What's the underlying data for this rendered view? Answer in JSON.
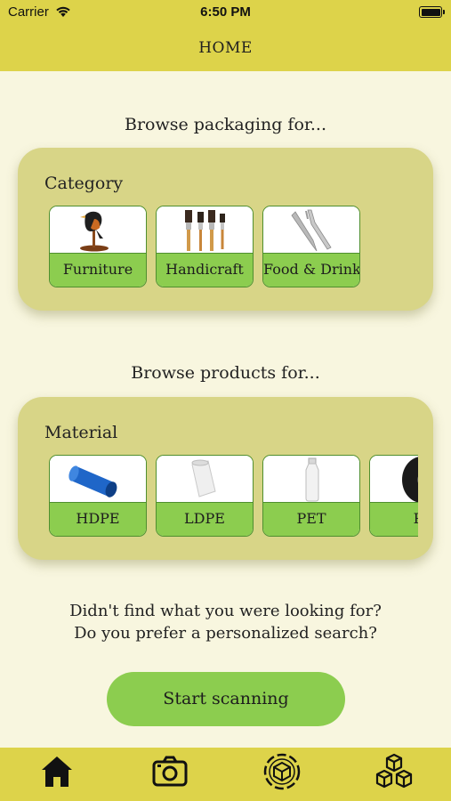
{
  "status_bar": {
    "carrier": "Carrier",
    "time": "6:50 PM",
    "battery": "full"
  },
  "nav": {
    "title": "HOME"
  },
  "packaging": {
    "heading": "Browse packaging for...",
    "label": "Category",
    "items": [
      {
        "label": "Furniture",
        "icon": "bird-figurine-icon"
      },
      {
        "label": "Handicraft",
        "icon": "paintbrushes-icon"
      },
      {
        "label": "Food & Drinks",
        "icon": "cutlery-icon"
      }
    ]
  },
  "products": {
    "heading": "Browse products for...",
    "label": "Material",
    "items": [
      {
        "label": "HDPE",
        "icon": "blue-pipe-icon"
      },
      {
        "label": "LDPE",
        "icon": "film-roll-icon"
      },
      {
        "label": "PET",
        "icon": "plastic-bottle-icon"
      },
      {
        "label": "P",
        "icon": "black-roll-icon"
      }
    ]
  },
  "prompt": {
    "line1": "Didn't find what you were looking for?",
    "line2": "Do you prefer a personalized search?"
  },
  "scan_button": {
    "label": "Start scanning"
  },
  "tabs": [
    {
      "name": "home",
      "icon": "home-icon",
      "active": true
    },
    {
      "name": "camera",
      "icon": "camera-icon"
    },
    {
      "name": "scan",
      "icon": "scan-cube-icon"
    },
    {
      "name": "boxes",
      "icon": "boxes-icon"
    }
  ],
  "colors": {
    "bar": "#ddd34a",
    "background": "#f8f6df",
    "panel": "#d8d587",
    "accent_green": "#8ccd4f",
    "tile_border": "#4f8f2f"
  }
}
